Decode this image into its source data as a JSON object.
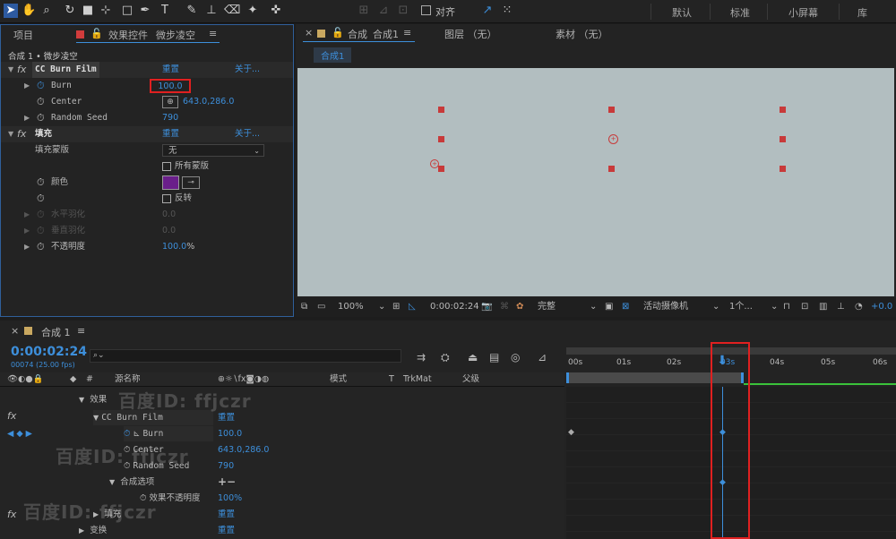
{
  "toolbar": {
    "align_label": "对齐",
    "workspaces": [
      "默认",
      "标准",
      "小屏幕",
      "库"
    ]
  },
  "effect_controls": {
    "tab_project": "项目",
    "tab_effects": "效果控件",
    "layer_name": "微步凌空",
    "breadcrumb": "合成 1 • 微步凌空",
    "effect1": {
      "name": "CC Burn Film",
      "reset": "重置",
      "about": "关于...",
      "burn_label": "Burn",
      "burn_value": "100.0",
      "center_label": "Center",
      "center_value": "643.0,286.0",
      "seed_label": "Random Seed",
      "seed_value": "790"
    },
    "effect2": {
      "name": "填充",
      "reset": "重置",
      "about": "关于...",
      "mask_label": "填充蒙版",
      "mask_value": "无",
      "all_masks": "所有蒙版",
      "color_label": "颜色",
      "color_value": "#6a1f8a",
      "invert": "反转",
      "h_feather_label": "水平羽化",
      "h_feather_value": "0.0",
      "v_feather_label": "垂直羽化",
      "v_feather_value": "0.0",
      "opacity_label": "不透明度",
      "opacity_value": "100.0",
      "opacity_unit": "%"
    }
  },
  "composition": {
    "tab_prefix": "合成",
    "tab_name": "合成1",
    "layer_tab": "图层 （无）",
    "footage_tab": "素材 （无）",
    "sub_tab": "合成1",
    "zoom": "100%",
    "timecode": "0:00:02:24",
    "quality": "完整",
    "camera": "活动摄像机",
    "views": "1个...",
    "exposure": "+0.0"
  },
  "timeline": {
    "comp_tab": "合成 1",
    "timecode": "0:00:02:24",
    "frame_info": "00074 (25.00 fps)",
    "search_placeholder": "",
    "col_source": "源名称",
    "col_mode": "模式",
    "col_t": "T",
    "col_trkmat": "TrkMat",
    "col_parent": "父级",
    "ruler": [
      "00s",
      "01s",
      "02s",
      "03s",
      "04s",
      "05s",
      "06s"
    ],
    "rows": {
      "effects": "效果",
      "burn_film": "CC Burn Film",
      "burn_film_reset": "重置",
      "burn": "Burn",
      "burn_value": "100.0",
      "center": "Center",
      "center_value": "643.0,286.0",
      "seed": "Random Seed",
      "seed_value": "790",
      "comp_options": "合成选项",
      "comp_options_ctrl": "+−",
      "effect_opacity": "效果不透明度",
      "effect_opacity_value": "100%",
      "fill": "填充",
      "fill_reset": "重置",
      "transform": "变换",
      "transform_reset": "重置"
    }
  },
  "watermark": "百度ID: ffjczr"
}
